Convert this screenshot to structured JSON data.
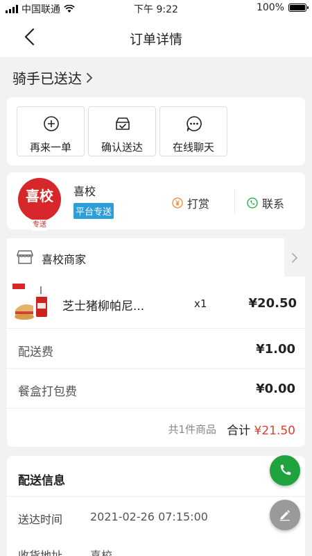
{
  "status_bar": {
    "carrier": "中国联通",
    "time": "下午 9:22",
    "battery": "100%",
    "battery_level": 1.0
  },
  "nav": {
    "title": "订单详情",
    "back_icon": "chevron-left-icon"
  },
  "order_status": {
    "text": "骑手已送达",
    "arrow_icon": "chevron-right-icon"
  },
  "actions": [
    {
      "label": "再来一单",
      "icon": "plus-circle-icon"
    },
    {
      "label": "确认送达",
      "icon": "inbox-check-icon"
    },
    {
      "label": "在线聊天",
      "icon": "chat-dots-icon"
    }
  ],
  "rider": {
    "logo_text": "喜校",
    "logo_sub": "专送",
    "name": "喜校",
    "tag": "平台专送",
    "tip_label": "打赏",
    "contact_label": "联系",
    "colors": {
      "logo": "#d8272a",
      "tag": "#2e9ed8",
      "tip_icon": "#f0882a",
      "contact_icon": "#1ea33e"
    }
  },
  "order": {
    "merchant": "喜校商家",
    "item": {
      "name": "芝士猪柳帕尼...",
      "qty": "x1",
      "price": "¥20.50"
    },
    "fees": [
      {
        "label": "配送费",
        "value": "¥1.00"
      },
      {
        "label": "餐盒打包费",
        "value": "¥0.00"
      }
    ],
    "count_text": "共1件商品",
    "total_label": "合计",
    "total_amount": "¥21.50",
    "accent": "#e23d2a"
  },
  "delivery": {
    "title": "配送信息",
    "rows": [
      {
        "label": "送达时间",
        "value": "2021-02-26 07:15:00"
      },
      {
        "label": "收货地址",
        "value": "喜校"
      }
    ]
  },
  "fabs": {
    "call_icon": "phone-icon",
    "edit_icon": "pencil-icon",
    "call_color": "#1ea33e"
  }
}
